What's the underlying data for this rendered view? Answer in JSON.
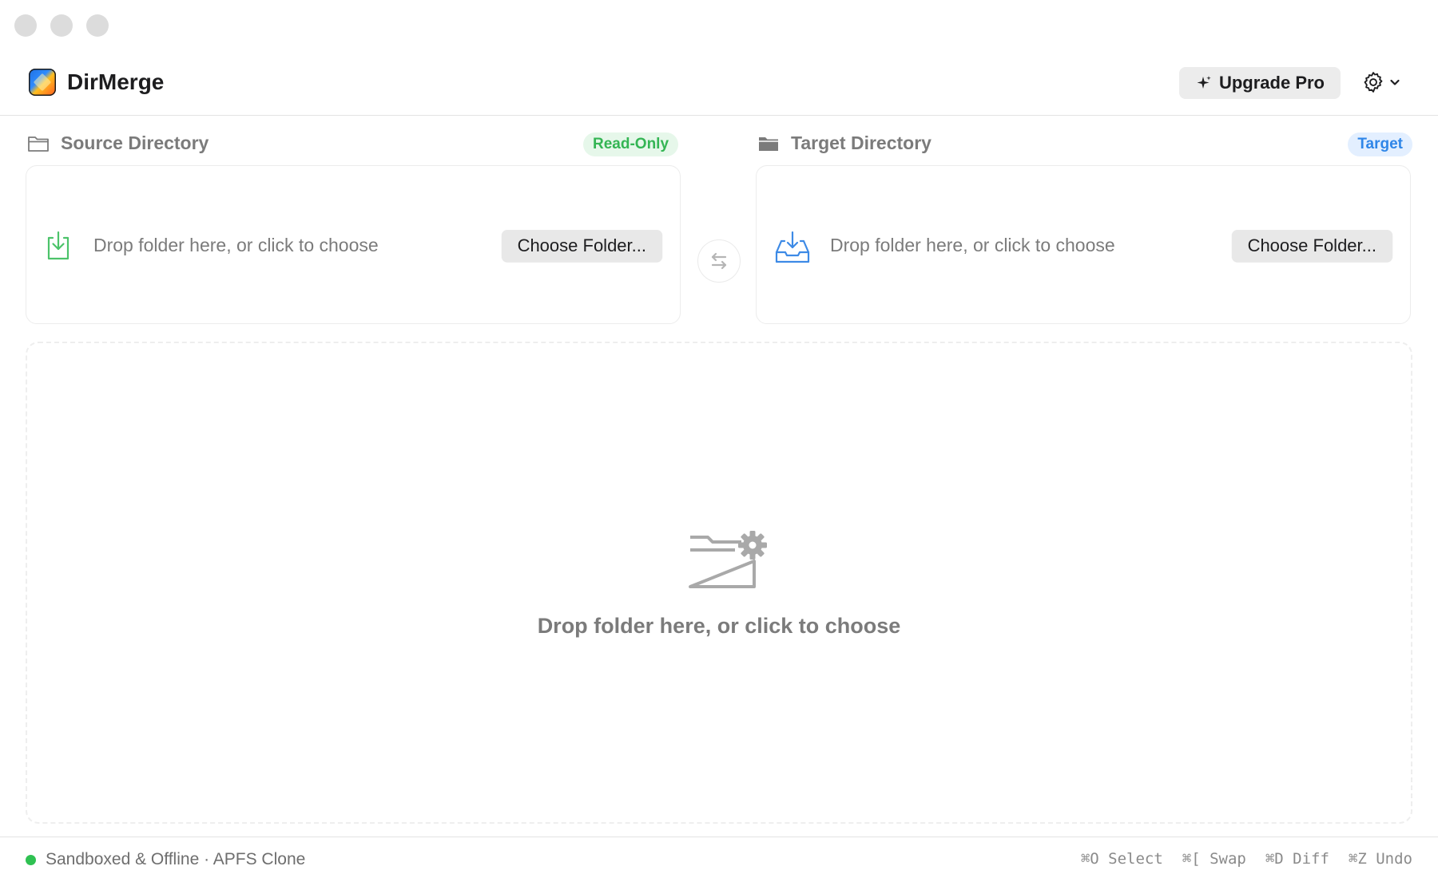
{
  "app": {
    "title": "DirMerge"
  },
  "header": {
    "upgrade_label": "Upgrade Pro"
  },
  "source": {
    "label": "Source Directory",
    "badge": "Read-Only",
    "drop_text": "Drop folder here, or click to choose",
    "button_label": "Choose Folder..."
  },
  "target": {
    "label": "Target Directory",
    "badge": "Target",
    "drop_text": "Drop folder here, or click to choose",
    "button_label": "Choose Folder..."
  },
  "dropzone": {
    "text": "Drop folder here, or click to choose"
  },
  "footer": {
    "status": "Sandboxed & Offline · APFS Clone",
    "shortcuts": [
      "⌘O Select",
      "⌘[ Swap",
      "⌘D Diff",
      "⌘Z Undo"
    ]
  },
  "colors": {
    "status_green": "#2fc152",
    "readonly_green": "#34b554",
    "target_blue": "#2f86e8",
    "source_icon_green": "#4cc36a",
    "target_icon_blue": "#3d8ae6"
  },
  "icons": {
    "window_controls": [
      "close-dot",
      "minimize-dot",
      "zoom-dot"
    ],
    "logo": "app-logo-icon",
    "upgrade": "sparkle-icon",
    "settings": "gear-icon",
    "settings_menu": "chevron-down-icon",
    "source_header": "folder-outline-icon",
    "target_header": "folder-filled-icon",
    "source_drop": "download-tray-icon",
    "target_drop": "inbox-download-icon",
    "swap": "swap-arrows-icon",
    "dropzone": "folder-gear-icon"
  }
}
